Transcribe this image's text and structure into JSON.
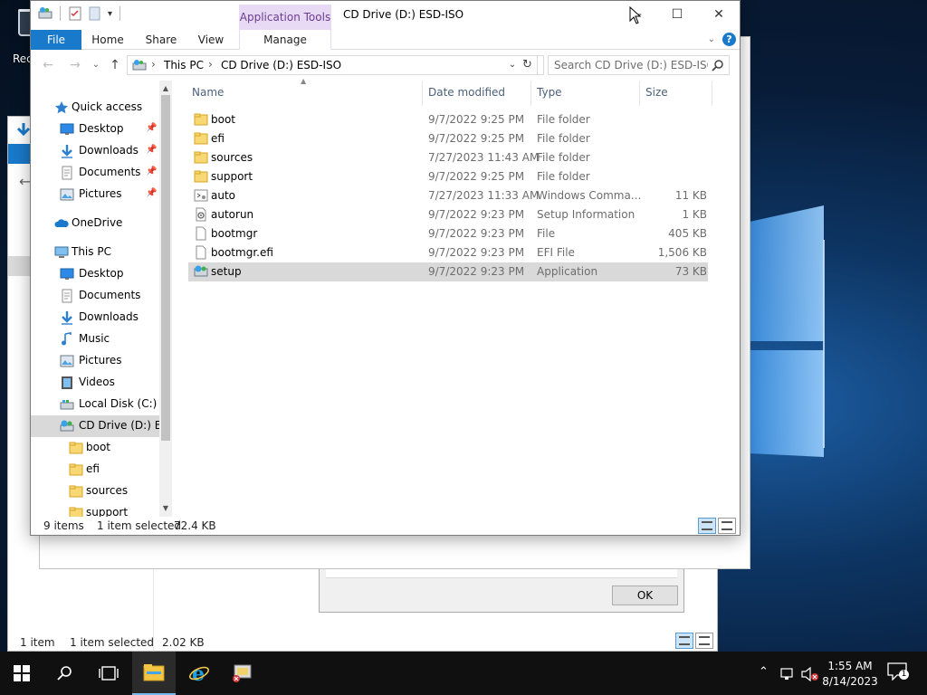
{
  "desktop": {
    "recycle_label": "Recy"
  },
  "back_window": {
    "status_items": "1 item",
    "status_selected": "1 item selected",
    "status_size": "2.02 KB",
    "dialog_ok": "OK"
  },
  "window": {
    "title": "CD Drive (D:) ESD-ISO",
    "context_tab_group": "Application Tools",
    "ribbon_tabs": {
      "file": "File",
      "home": "Home",
      "share": "Share",
      "view": "View",
      "manage": "Manage"
    },
    "breadcrumb": {
      "root": "This PC",
      "current": "CD Drive (D:) ESD-ISO"
    },
    "search_placeholder": "Search CD Drive (D:) ESD-ISO"
  },
  "nav_pane": {
    "items": [
      {
        "label": "Quick access",
        "icon": "star-icon"
      },
      {
        "label": "Desktop",
        "icon": "desktop-icon",
        "pinned": true
      },
      {
        "label": "Downloads",
        "icon": "download-icon",
        "pinned": true
      },
      {
        "label": "Documents",
        "icon": "documents-icon",
        "pinned": true
      },
      {
        "label": "Pictures",
        "icon": "pictures-icon",
        "pinned": true
      },
      {
        "label": "OneDrive",
        "icon": "cloud-icon"
      },
      {
        "label": "This PC",
        "icon": "computer-icon"
      },
      {
        "label": "Desktop",
        "icon": "desktop-icon"
      },
      {
        "label": "Documents",
        "icon": "documents-icon"
      },
      {
        "label": "Downloads",
        "icon": "download-icon"
      },
      {
        "label": "Music",
        "icon": "music-icon"
      },
      {
        "label": "Pictures",
        "icon": "pictures-icon"
      },
      {
        "label": "Videos",
        "icon": "videos-icon"
      },
      {
        "label": "Local Disk (C:)",
        "icon": "drive-icon"
      },
      {
        "label": "CD Drive (D:) ESD",
        "icon": "cd-drive-icon",
        "selected": true
      },
      {
        "label": "boot",
        "icon": "folder-icon"
      },
      {
        "label": "efi",
        "icon": "folder-icon"
      },
      {
        "label": "sources",
        "icon": "folder-icon"
      },
      {
        "label": "support",
        "icon": "folder-icon"
      }
    ]
  },
  "file_list": {
    "columns": {
      "name": "Name",
      "date": "Date modified",
      "type": "Type",
      "size": "Size"
    },
    "rows": [
      {
        "name": "boot",
        "date": "9/7/2022 9:25 PM",
        "type": "File folder",
        "size": "",
        "icon": "folder-icon"
      },
      {
        "name": "efi",
        "date": "9/7/2022 9:25 PM",
        "type": "File folder",
        "size": "",
        "icon": "folder-icon"
      },
      {
        "name": "sources",
        "date": "7/27/2023 11:43 AM",
        "type": "File folder",
        "size": "",
        "icon": "folder-icon"
      },
      {
        "name": "support",
        "date": "9/7/2022 9:25 PM",
        "type": "File folder",
        "size": "",
        "icon": "folder-icon"
      },
      {
        "name": "auto",
        "date": "7/27/2023 11:33 AM",
        "type": "Windows Comma...",
        "size": "11 KB",
        "icon": "script-icon"
      },
      {
        "name": "autorun",
        "date": "9/7/2022 9:23 PM",
        "type": "Setup Information",
        "size": "1 KB",
        "icon": "setup-info-icon"
      },
      {
        "name": "bootmgr",
        "date": "9/7/2022 9:23 PM",
        "type": "File",
        "size": "405 KB",
        "icon": "file-icon"
      },
      {
        "name": "bootmgr.efi",
        "date": "9/7/2022 9:23 PM",
        "type": "EFI File",
        "size": "1,506 KB",
        "icon": "file-icon"
      },
      {
        "name": "setup",
        "date": "9/7/2022 9:23 PM",
        "type": "Application",
        "size": "73 KB",
        "icon": "setup-app-icon",
        "selected": true
      }
    ]
  },
  "status": {
    "items": "9 items",
    "selected": "1 item selected",
    "size": "72.4 KB"
  },
  "taskbar": {
    "time": "1:55 AM",
    "date": "8/14/2023",
    "notification_count": "1",
    "accent": "#76b9ed"
  }
}
